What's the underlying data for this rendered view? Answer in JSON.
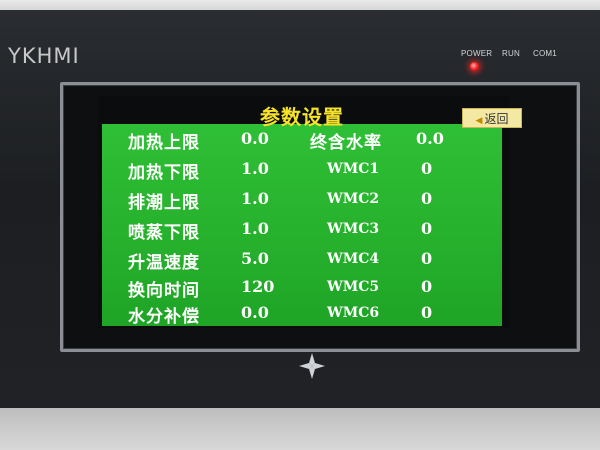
{
  "device": {
    "brand": "YKHMI",
    "indicators": [
      "POWER",
      "RUN",
      "COM1"
    ],
    "led_color": "#ff2a2a"
  },
  "screen": {
    "title": "参数设置",
    "back_label": "返回",
    "colors": {
      "panel": "#2fbf36",
      "title": "#f7e22a",
      "button": "#f4e9a2"
    },
    "left_params": [
      {
        "label": "加热上限",
        "value": "0.0"
      },
      {
        "label": "加热下限",
        "value": "1.0"
      },
      {
        "label": "排潮上限",
        "value": "1.0"
      },
      {
        "label": "喷蒸下限",
        "value": "1.0"
      },
      {
        "label": "升温速度",
        "value": "5.0"
      },
      {
        "label": "换向时间",
        "value": "120"
      },
      {
        "label": "水分补偿",
        "value": "0.0"
      }
    ],
    "right_params": [
      {
        "label": "终含水率",
        "value": "0.0"
      },
      {
        "label": "WMC1",
        "value": "0"
      },
      {
        "label": "WMC2",
        "value": "0"
      },
      {
        "label": "WMC3",
        "value": "0"
      },
      {
        "label": "WMC4",
        "value": "0"
      },
      {
        "label": "WMC5",
        "value": "0"
      },
      {
        "label": "WMC6",
        "value": "0"
      }
    ]
  }
}
